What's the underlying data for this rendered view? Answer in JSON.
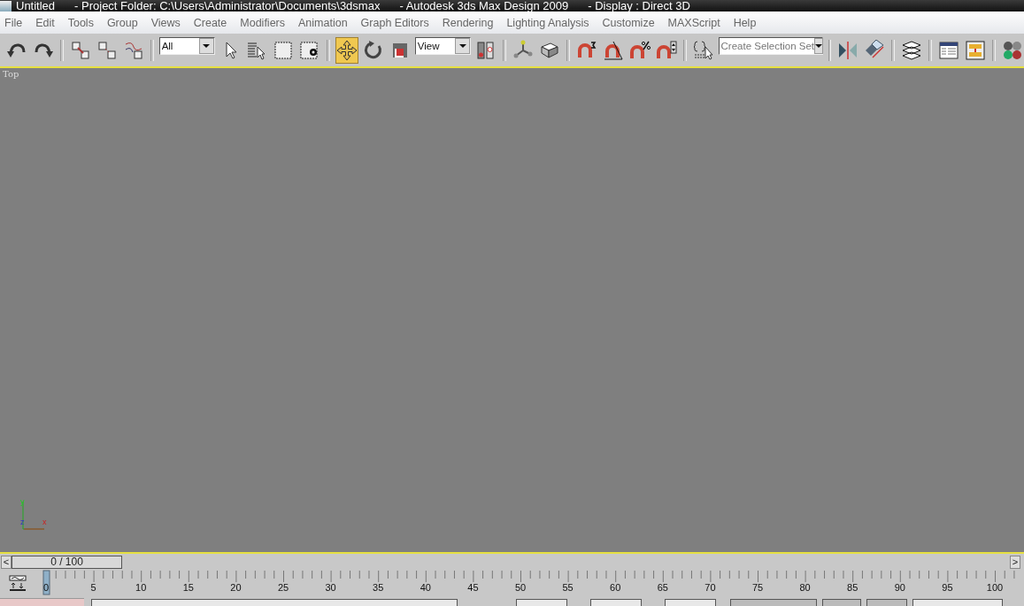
{
  "window": {
    "title_parts": [
      "Untitled",
      "- Project Folder: C:\\Users\\Administrator\\Documents\\3dsmax",
      "- Autodesk 3ds Max Design 2009",
      "- Display : Direct 3D"
    ]
  },
  "menu": [
    "File",
    "Edit",
    "Tools",
    "Group",
    "Views",
    "Create",
    "Modifiers",
    "Animation",
    "Graph Editors",
    "Rendering",
    "Lighting Analysis",
    "Customize",
    "MAXScript",
    "Help"
  ],
  "toolbar": {
    "selection_filter": "All",
    "reference_coordinate": "View",
    "named_selection_placeholder": "Create Selection Set",
    "move_tool": {
      "selected": true
    }
  },
  "viewport": {
    "label": "Top",
    "axes": [
      "y",
      "z",
      "x"
    ]
  },
  "time_slider": {
    "prev": "<",
    "label": "0 / 100",
    "next": ">",
    "level": 0
  },
  "track_bar": {
    "labels": [
      "0",
      "5",
      "10",
      "15",
      "20",
      "25",
      "30",
      "35",
      "40",
      "45",
      "50",
      "55",
      "60",
      "65",
      "70",
      "75",
      "80",
      "85",
      "90",
      "95",
      "100"
    ]
  }
}
